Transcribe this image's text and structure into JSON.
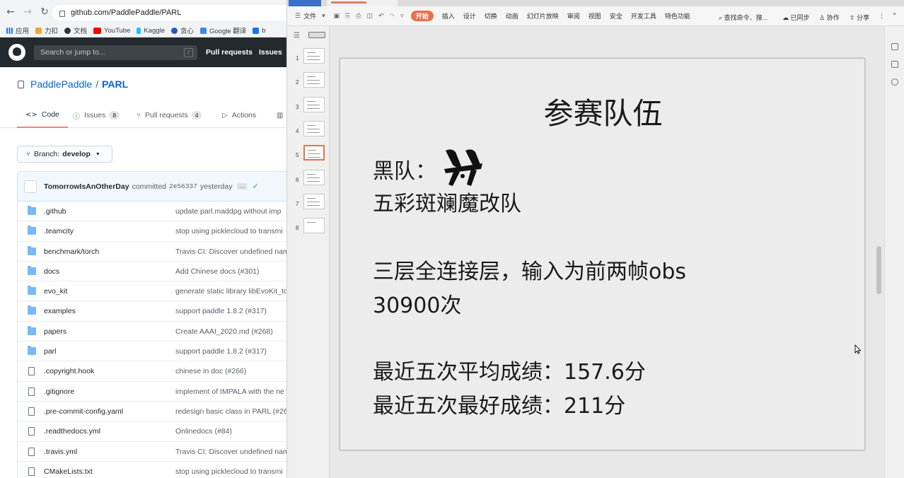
{
  "browser": {
    "url": "github.com/PaddlePaddle/PARL",
    "bookmarks": [
      "应用",
      "力扣",
      "文档",
      "YouTube",
      "Kaggle",
      "贪心",
      "Google 翻译",
      "b"
    ],
    "search_placeholder": "Search or jump to...",
    "search_key": "/",
    "nav_links": [
      "Pull requests",
      "Issues"
    ],
    "repo_owner": "PaddlePaddle",
    "repo_name": "PARL",
    "tabs": [
      {
        "label": "Code",
        "count": ""
      },
      {
        "label": "Issues",
        "count": "8"
      },
      {
        "label": "Pull requests",
        "count": "4"
      },
      {
        "label": "Actions",
        "count": ""
      }
    ],
    "branch_label": "Branch:",
    "branch_name": "develop",
    "commit": {
      "author": "TomorrowIsAnOtherDay",
      "verb": "committed",
      "sha": "2e56337",
      "when": "yesterday",
      "dots": "…"
    },
    "files": [
      {
        "name": ".github",
        "type": "dir",
        "msg": "update parl.maddpg without imp"
      },
      {
        "name": ".teamcity",
        "type": "dir",
        "msg": "stop using picklecloud to transmi"
      },
      {
        "name": "benchmark/torch",
        "type": "dir",
        "msg": "Travis CI: Discover undefined nam"
      },
      {
        "name": "docs",
        "type": "dir",
        "msg": "Add Chinese docs (#301)"
      },
      {
        "name": "evo_kit",
        "type": "dir",
        "msg": "generate static library libEvoKit_to"
      },
      {
        "name": "examples",
        "type": "dir",
        "msg": "support paddle 1.8.2 (#317)"
      },
      {
        "name": "papers",
        "type": "dir",
        "msg": "Create AAAI_2020.md (#268)"
      },
      {
        "name": "parl",
        "type": "dir",
        "msg": "support paddle 1.8.2 (#317)"
      },
      {
        "name": ".copyright.hook",
        "type": "file",
        "msg": "chinese in doc (#266)"
      },
      {
        "name": ".gitignore",
        "type": "file",
        "msg": "implement of IMPALA with the ne"
      },
      {
        "name": ".pre-commit-config.yaml",
        "type": "file",
        "msg": "redesign basic class in PARL (#26)"
      },
      {
        "name": ".readthedocs.yml",
        "type": "file",
        "msg": "Onlinedocs (#84)"
      },
      {
        "name": ".travis.yml",
        "type": "file",
        "msg": "Travis CI: Discover undefined nam"
      },
      {
        "name": "CMakeLists.txt",
        "type": "file",
        "msg": "stop using picklecloud to transmi"
      }
    ]
  },
  "wps": {
    "menu": {
      "file": "文件",
      "start": "开始",
      "items": [
        "插入",
        "设计",
        "切换",
        "动画",
        "幻灯片放映",
        "审阅",
        "视图",
        "安全",
        "开发工具",
        "特色功能"
      ],
      "search": "查找命令、搜...",
      "sync": "已同步",
      "collab": "协作",
      "share": "分享"
    },
    "thumb_numbers": [
      "1",
      "2",
      "3",
      "4",
      "5",
      "6",
      "7",
      "8"
    ],
    "active_slide": 5,
    "slide": {
      "title": "参赛队伍",
      "team_label": "黑队：",
      "team_name": "五彩斑斓魔改队",
      "network": "三层全连接层，输入为前两帧obs",
      "episodes": "30900次",
      "avg_score": "最近五次平均成绩：157.6分",
      "best_score": "最近五次最好成绩：211分"
    }
  },
  "colors": {
    "gh_header": "#24292e",
    "gh_link": "#0366d6",
    "wps_accent": "#e8714a",
    "slide_bg": "#ececec"
  }
}
